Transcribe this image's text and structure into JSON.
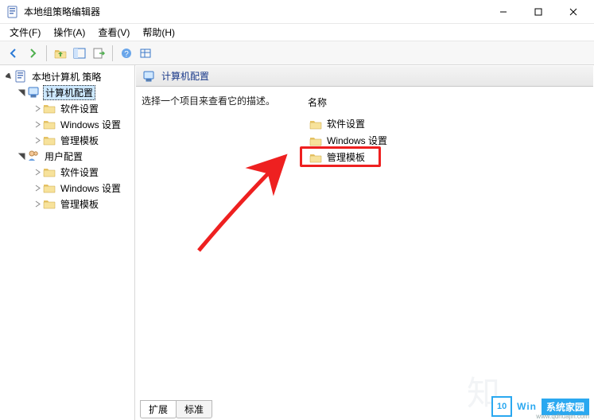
{
  "window": {
    "title": "本地组策略编辑器",
    "min": "—",
    "max": "☐",
    "close": "✕"
  },
  "menu": {
    "file": "文件(F)",
    "action": "操作(A)",
    "view": "查看(V)",
    "help": "帮助(H)"
  },
  "tree": {
    "root": "本地计算机 策略",
    "computer": "计算机配置",
    "comp_children": [
      "软件设置",
      "Windows 设置",
      "管理模板"
    ],
    "user": "用户配置",
    "user_children": [
      "软件设置",
      "Windows 设置",
      "管理模板"
    ]
  },
  "right": {
    "header": "计算机配置",
    "description": "选择一个项目来查看它的描述。",
    "name_col": "名称",
    "items": [
      "软件设置",
      "Windows 设置",
      "管理模板"
    ]
  },
  "tabs": {
    "extended": "扩展",
    "standard": "标准"
  },
  "watermark": {
    "brand1": "Win",
    "brand2": "系统家园",
    "badge": "10",
    "url": "www.qdhuajin.com"
  }
}
